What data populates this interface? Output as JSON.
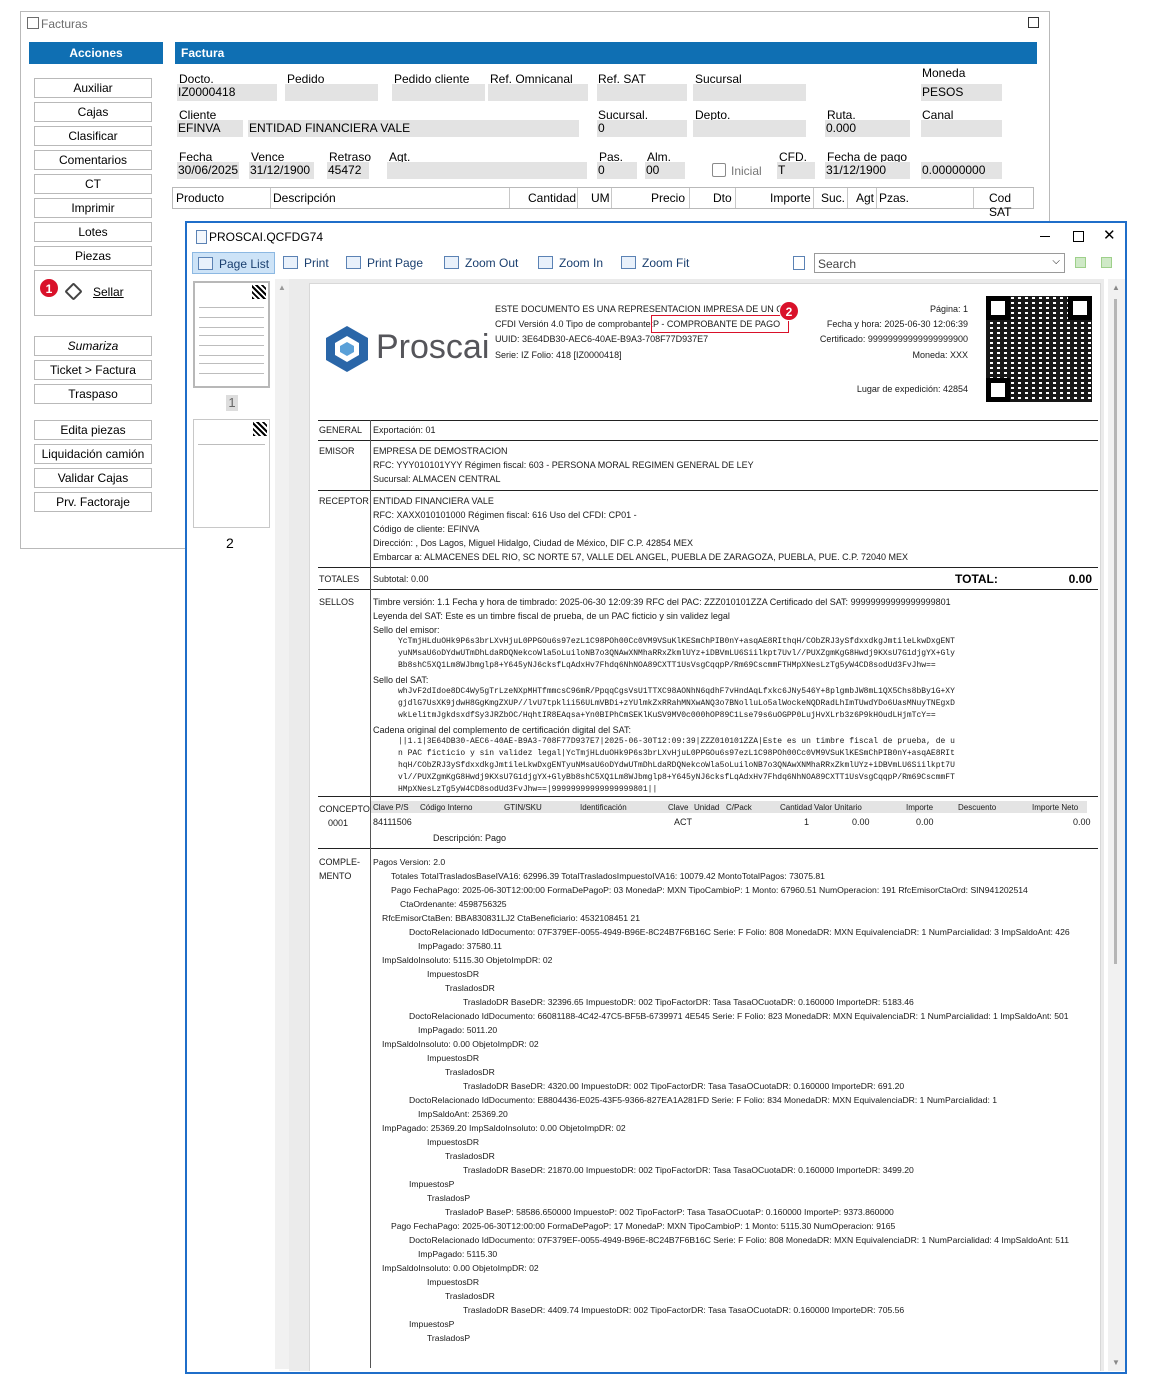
{
  "bg_window": {
    "title": "Facturas"
  },
  "acciones": {
    "title": "Acciones",
    "buttons": [
      "Auxiliar",
      "Cajas",
      "Clasificar",
      "Comentarios",
      "CT",
      "Imprimir",
      "Lotes",
      "Piezas"
    ],
    "sellar": "Sellar",
    "buttons2": [
      "Sumariza",
      "Ticket > Factura",
      "Traspaso"
    ],
    "buttons3": [
      "Edita piezas",
      "Liquidación camión",
      "Validar Cajas",
      "Prv. Factoraje"
    ]
  },
  "factura": {
    "title": "Factura",
    "docto_label": "Docto.",
    "docto": "IZ0000418",
    "pedido_label": "Pedido",
    "pedido_cliente_label": "Pedido cliente",
    "ref_omni_label": "Ref. Omnicanal",
    "ref_sat_label": "Ref. SAT",
    "sucursal_label": "Sucursal",
    "moneda_label": "Moneda",
    "moneda": "PESOS",
    "cliente_label": "Cliente",
    "cliente": "EFINVA",
    "cliente_nombre": "ENTIDAD FINANCIERA VALE",
    "sucursal2_label": "Sucursal.",
    "sucursal2": "0",
    "depto_label": "Depto.",
    "ruta_label": "Ruta.",
    "ruta": "0.000",
    "canal_label": "Canal",
    "fecha_label": "Fecha",
    "fecha": "30/06/2025",
    "vence_label": "Vence",
    "vence": "31/12/1900",
    "retraso_label": "Retraso",
    "retraso": "45472",
    "agt_label": "Agt.",
    "pas_label": "Pas.",
    "pas": "0",
    "alm_label": "Alm.",
    "alm": "00",
    "inicial_label": "Inicial",
    "cfd_label": "CFD.",
    "cfd": "T",
    "fecha_pago_label": "Fecha de pago",
    "fecha_pago": "31/12/1900",
    "tc": "0.00000000"
  },
  "grid_headers": [
    "Producto",
    "Descripción",
    "Cantidad",
    "UM",
    "Precio",
    "Dto",
    "Importe",
    "Suc.",
    "Agt",
    "Pzas.",
    "Cod SAT"
  ],
  "badges": {
    "b1": "1",
    "b2": "2"
  },
  "viewer": {
    "title": "PROSCAI.QCFDG74",
    "toolbar": {
      "page_list": "Page List",
      "print": "Print",
      "print_page": "Print Page",
      "zoom_out": "Zoom Out",
      "zoom_in": "Zoom In",
      "zoom_fit": "Zoom Fit",
      "search_placeholder": "Search"
    },
    "thumb_labels": [
      "1",
      "2"
    ]
  },
  "doc": {
    "logo": "Proscai",
    "h1": "ESTE DOCUMENTO ES UNA REPRESENTACION IMPRESA DE UN CFDI",
    "h2a": "CFDI Versión 4.0   Tipo de comprobante:",
    "h2b": "P - COMPROBANTE DE PAGO",
    "h3": "UUID: 3E64DB30-AEC6-40AE-B9A3-708F77D937E7",
    "h4": "Serie: IZ    Folio: 418    [IZ0000418]",
    "pagina": "Página: 1",
    "fecha_hora": "Fecha y hora: 2025-06-30 12:06:39",
    "certificado": "Certificado: 99999999999999999900",
    "moneda": "Moneda: XXX",
    "lugar": "Lugar de expedición: 42854",
    "general_h": "GENERAL",
    "general": "Exportación: 01",
    "emisor_h": "EMISOR",
    "emisor": [
      "EMPRESA DE DEMOSTRACION",
      "RFC: YYY010101YYY    Régimen fiscal: 603  -   PERSONA MORAL REGIMEN GENERAL DE LEY",
      "Sucursal: ALMACEN CENTRAL"
    ],
    "receptor_h": "RECEPTOR",
    "receptor": [
      "ENTIDAD FINANCIERA VALE",
      "RFC: XAXX010101000    Régimen fiscal: 616    Uso del CFDI: CP01  -",
      "Código de cliente: EFINVA",
      "Dirección:  ,   Dos Lagos,   Miguel Hidalgo,   Ciudad de México,   DIF   C.P.  42854   MEX",
      "Embarcar a: ALMACENES DEL RIO, SC     NORTE 57, VALLE DEL ANGEL, PUEBLA DE ZARAGOZA,   PUEBLA,   PUE.   C.P.  72040   MEX"
    ],
    "totales_h": "TOTALES",
    "subtotal": "Subtotal:  0.00",
    "total_l": "TOTAL:",
    "total_v": "0.00",
    "sellos_h": "SELLOS",
    "sellos1": "Timbre versión:  1.1     Fecha y hora de timbrado: 2025-06-30 12:09:39     RFC del PAC: ZZZ010101ZZA     Certificado del SAT: 99999999999999999801",
    "sellos2": "Leyenda del SAT: Este es un timbre fiscal de prueba, de un PAC ficticio y sin validez legal",
    "sello_emisor_l": "Sello del emisor:",
    "sello_emisor": [
      "YcTmjHLduOHk9P6s3brLXvHjuL0PPGOu6s97ezL1C98POh00Cc0VM9VSuKlKESmChPIB0nY+asqAE8RIthqH/CObZRJ3ySfdxxdkgJmtileLkwDxgENT",
      "yuNMsaU6oDYdwUTmDhLdaRDQNekcoWla5oLuiloNB7o3QNAwXNMhaRRxZkmlUYz+iDBVmLU6Siilkpt7Uvl//PUXZgmKgG8Hwdj9KXsU7G1djgYX+Gly",
      "Bb8shC5XQ1Lm8WJbmglp8+Y645yNJ6cksfLqAdxHv7Fhdq6NhNOA89CXTT1UsVsgCqqpP/Rm69CscmmFTHMpXNesLzTg5yW4CD8sodUd3FvJhw=="
    ],
    "sello_sat_l": "Sello del SAT:",
    "sello_sat": [
      "whJvF2dIdoe8DC4Wy5gTrLzeNXpMHTfmmcsC96mR/PpqqCgsVsU1TTXC98AONhN6qdhF7vHndAqLfxkc6JNy546Y+8plgmbJW8mL1QX5Chs8bBy1G+XY",
      "gjdlG7UsXK9jdwH8GgKmgZXUP//lvU7tpklii56ULmVBDi+zYUlmkZxRRahMNXwANQ3o7BNolluLo5alWockeNQDRadLhImTUwdYDo6UasMNuyTNEgxD",
      "wkLelitmJgkdsxdfSy3JRZbOC/HqhtIR8EAqsa+Yn0BIPhCmSEKlKuSV9MV0c000hOP89C1Lse79s6uOGPP0LujHvXLrb3z6P9kHOudLHjmTcY=="
    ],
    "cadena_l": "Cadena original del complemento de certificación digital del SAT:",
    "cadena": [
      "||1.1|3E64DB30-AEC6-40AE-B9A3-708F77D937E7|2025-06-30T12:09:39|ZZZ010101ZZA|Este es un timbre fiscal de prueba, de u",
      "n PAC ficticio y sin validez legal|YcTmjHLduOHk9P6s3brLXvHjuL0PPGOu6s97ezL1C98POh00Cc0VM9VSuKlKESmChPIB0nY+asqAE8RIt",
      "hqH/CObZRJ3ySfdxxdkgJmtileLkwDxgENTyuNMsaU6oDYdwUTmDhLdaRDQNekcoWla5oLuiloNB7o3QNAwXNMhaRRxZkmlUYz+iDBVmLU6Siilkpt7U",
      "vl//PUXZgmKgG8Hwdj9KXsU7G1djgYX+GlyBb8shC5XQ1Lm8WJbmglp8+Y645yNJ6cksfLqAdxHv7Fhdq6NhNOA89CXTT1UsVsgCqqpP/Rm69CscmmFT",
      "HMpXNesLzTg5yW4CD8sodUd3FvJhw==|99999999999999999801||"
    ],
    "concepto_h": "CONCEPTO",
    "concepto_num": "0001",
    "concepto_cols": [
      "Clave P/S",
      "Código Interno",
      "GTIN/SKU",
      "Identificación",
      "Clave",
      "Unidad",
      "C/Pack",
      "Cantidad",
      "Valor Unitario",
      "Importe",
      "Descuento",
      "Importe Neto"
    ],
    "concepto_vals": {
      "clave": "84111506",
      "clave_u": "ACT",
      "cantidad": "1",
      "valor": "0.00",
      "importe": "0.00",
      "neto": "0.00"
    },
    "concepto_desc": "Descripción: Pago",
    "comp_h1": "COMPLE-",
    "comp_h2": "MENTO",
    "comp": [
      [
        "0",
        "Pagos    Version: 2.0"
      ],
      [
        "2",
        "Totales    TotalTrasladosBaseIVA16: 62996.39     TotalTrasladosImpuestoIVA16: 10079.42     MontoTotalPagos: 73075.81"
      ],
      [
        "2",
        "Pago    FechaPago: 2025-06-30T12:00:00    FormaDePagoP: 03     MonedaP: MXN    TipoCambioP: 1     Monto: 67960.51     NumOperacion: 191     RfcEmisorCtaOrd: SIN941202514"
      ],
      [
        "3",
        "CtaOrdenante: 4598756325"
      ],
      [
        "1",
        "RfcEmisorCtaBen: BBA830831LJ2     CtaBeneficiario: 4532108451 21"
      ],
      [
        "4",
        "DoctoRelacionado     IdDocumento: 07F379EF-0055-4949-B96E-8C24B7F6B16C     Serie: F     Folio: 808     MonedaDR: MXN     EquivalenciaDR: 1     NumParcialidad: 3     ImpSaldoAnt: 426"
      ],
      [
        "5",
        "ImpPagado: 37580.11"
      ],
      [
        "1",
        "ImpSaldoInsoluto: 5115.30    ObjetoImpDR: 02"
      ],
      [
        "6",
        "ImpuestosDR"
      ],
      [
        "7",
        "TrasladosDR"
      ],
      [
        "8",
        "TrasladoDR     BaseDR: 32396.65     ImpuestoDR: 002     TipoFactorDR: Tasa     TasaOCuotaDR: 0.160000     ImporteDR: 5183.46"
      ],
      [
        "4",
        "DoctoRelacionado     IdDocumento: 66081188-4C42-47C5-BF5B-6739971 4E545     Serie: F     Folio: 823     MonedaDR: MXN     EquivalenciaDR: 1     NumParcialidad: 1     ImpSaldoAnt: 501"
      ],
      [
        "5",
        "ImpPagado: 5011.20"
      ],
      [
        "1",
        "ImpSaldoInsoluto: 0.00     ObjetoImpDR: 02"
      ],
      [
        "6",
        "ImpuestosDR"
      ],
      [
        "7",
        "TrasladosDR"
      ],
      [
        "8",
        "TrasladoDR     BaseDR: 4320.00     ImpuestoDR: 002     TipoFactorDR: Tasa     TasaOCuotaDR: 0.160000     ImporteDR: 691.20"
      ],
      [
        "4",
        "DoctoRelacionado     IdDocumento: E8804436-E025-43F5-9366-827EA1A281FD     Serie: F     Folio: 834     MonedaDR: MXN     EquivalenciaDR: 1     NumParcialidad: 1"
      ],
      [
        "5",
        "ImpSaldoAnt: 25369.20"
      ],
      [
        "1",
        "ImpPagado: 25369.20    ImpSaldoInsoluto: 0.00    ObjetoImpDR: 02"
      ],
      [
        "6",
        "ImpuestosDR"
      ],
      [
        "7",
        "TrasladosDR"
      ],
      [
        "8",
        "TrasladoDR     BaseDR: 21870.00     ImpuestoDR: 002     TipoFactorDR: Tasa     TasaOCuotaDR: 0.160000     ImporteDR: 3499.20"
      ],
      [
        "4",
        "ImpuestosP"
      ],
      [
        "9",
        "TrasladosP"
      ],
      [
        "10",
        "TrasladoP     BaseP: 58586.650000     ImpuestoP: 002     TipoFactorP: Tasa     TasaOCuotaP: 0.160000     ImporteP: 9373.860000"
      ],
      [
        "2",
        "Pago    FechaPago: 2025-06-30T12:00:00    FormaDePagoP: 17     MonedaP: MXN     TipoCambioP: 1     Monto: 5115.30     NumOperacion: 9165"
      ],
      [
        "4",
        "DoctoRelacionado     IdDocumento: 07F379EF-0055-4949-B96E-8C24B7F6B16C     Serie: F     Folio: 808     MonedaDR: MXN     EquivalenciaDR: 1     NumParcialidad: 4     ImpSaldoAnt: 511"
      ],
      [
        "5",
        "ImpPagado: 5115.30"
      ],
      [
        "1",
        "ImpSaldoInsoluto: 0.00     ObjetoImpDR: 02"
      ],
      [
        "6",
        "ImpuestosDR"
      ],
      [
        "7",
        "TrasladosDR"
      ],
      [
        "8",
        "TrasladoDR     BaseDR: 4409.74     ImpuestoDR: 002     TipoFactorDR: Tasa     TasaOCuotaDR: 0.160000     ImporteDR: 705.56"
      ],
      [
        "4",
        "ImpuestosP"
      ],
      [
        "9",
        "TrasladosP"
      ]
    ]
  }
}
